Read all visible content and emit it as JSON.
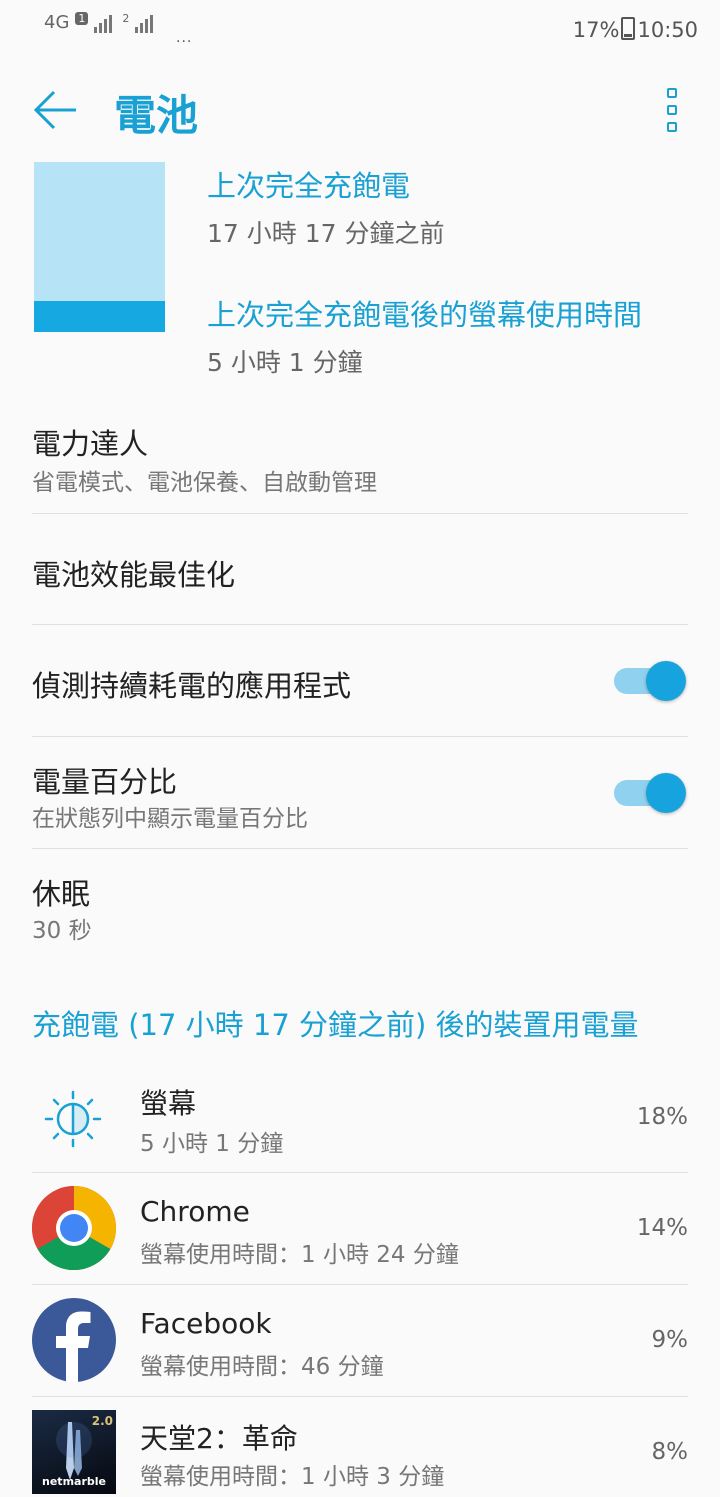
{
  "status_bar": {
    "network": "4G",
    "sim1": "1",
    "sim2": "2",
    "more": "...",
    "battery": "17%",
    "time": "10:50"
  },
  "app_bar": {
    "title": "電池"
  },
  "summary": {
    "last_full_charge_label": "上次完全充飽電",
    "last_full_charge_value": "17 小時 17 分鐘之前",
    "screen_time_label": "上次完全充飽電後的螢幕使用時間",
    "screen_time_value": "5 小時 1 分鐘"
  },
  "settings": [
    {
      "title": "電力達人",
      "subtitle": "省電模式、電池保養、自啟動管理"
    },
    {
      "title": "電池效能最佳化"
    },
    {
      "title": "偵測持續耗電的應用程式",
      "toggle": "on"
    },
    {
      "title": "電量百分比",
      "subtitle": "在狀態列中顯示電量百分比",
      "toggle": "on"
    },
    {
      "title": "休眠",
      "subtitle": "30 秒"
    }
  ],
  "usage_section": {
    "header": "充飽電 (17 小時 17 分鐘之前) 後的裝置用電量",
    "apps": [
      {
        "name": "螢幕",
        "detail": "5 小時 1 分鐘",
        "percent": "18%",
        "icon": "brightness-icon"
      },
      {
        "name": "Chrome",
        "detail": "螢幕使用時間：1 小時 24 分鐘",
        "percent": "14%",
        "icon": "chrome-icon"
      },
      {
        "name": "Facebook",
        "detail": "螢幕使用時間：46 分鐘",
        "percent": "9%",
        "icon": "facebook-icon"
      },
      {
        "name": "天堂2：革命",
        "detail": "螢幕使用時間：1 小時 3 分鐘",
        "percent": "8%",
        "icon": "lineage2-icon",
        "icon_text": "netmarble",
        "icon_badge": "2.0"
      }
    ]
  },
  "colors": {
    "accent": "#1aa1d4",
    "battery_light": "#b6e3f6",
    "battery_fill": "#16a8e0"
  }
}
